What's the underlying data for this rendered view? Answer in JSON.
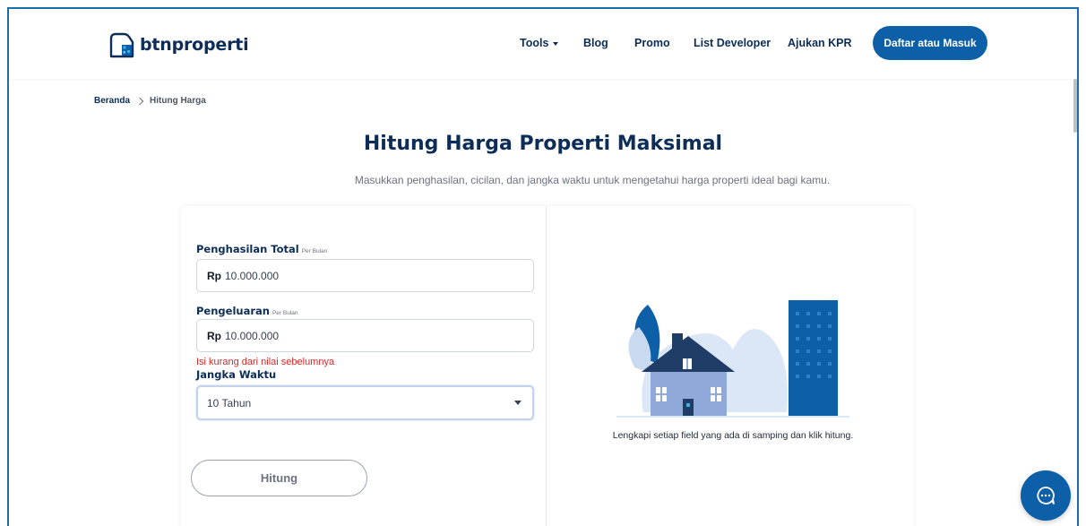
{
  "header": {
    "logo_text": "btnproperti",
    "nav": {
      "tools": "Tools",
      "blog": "Blog",
      "promo": "Promo",
      "list_developer": "List Developer",
      "ajukan_kpr": "Ajukan KPR"
    },
    "cta_label": "Daftar atau Masuk"
  },
  "breadcrumb": {
    "home": "Beranda",
    "current": "Hitung Harga"
  },
  "page": {
    "title": "Hitung Harga Properti Maksimal",
    "subtitle": "Masukkan penghasilan, cicilan, dan jangka waktu untuk mengetahui harga properti ideal bagi kamu."
  },
  "form": {
    "income": {
      "label": "Penghasilan Total",
      "sublabel": "Per Bulan",
      "currency": "Rp",
      "value": "10.000.000"
    },
    "expense": {
      "label": "Pengeluaran",
      "sublabel": "Per Bulan",
      "currency": "Rp",
      "value": "10.000.000",
      "error": "Isi kurang dari nilai sebelumnya"
    },
    "term": {
      "label": "Jangka Waktu",
      "selected": "10 Tahun"
    },
    "submit_label": "Hitung"
  },
  "result": {
    "hint": "Lengkapi setiap field yang ada di samping dan klik hitung."
  },
  "colors": {
    "brand": "#0d5fa8",
    "navy": "#0c2d57",
    "error": "#dc2626"
  }
}
